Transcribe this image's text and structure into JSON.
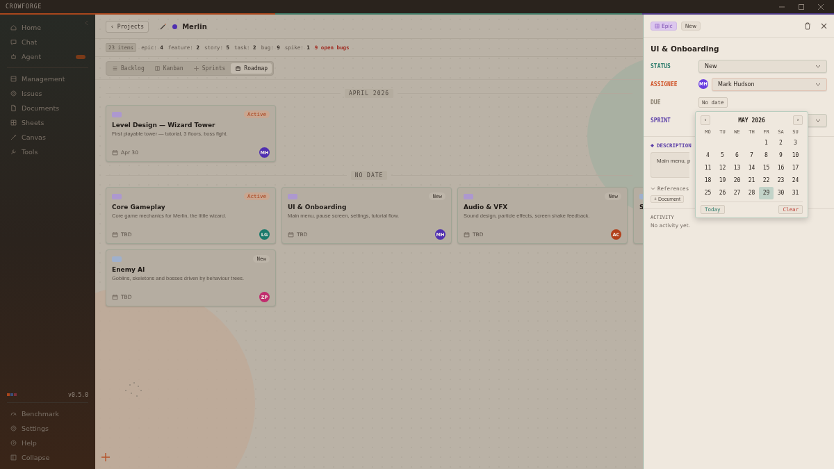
{
  "app": {
    "title": "CROWFORGE"
  },
  "sidebar": {
    "groups": [
      [
        {
          "label": "Home",
          "has_badge": false
        },
        {
          "label": "Chat",
          "has_badge": false
        },
        {
          "label": "Agent",
          "has_badge": true
        }
      ],
      [
        {
          "label": "Management",
          "has_badge": false
        },
        {
          "label": "Issues",
          "has_badge": false
        },
        {
          "label": "Documents",
          "has_badge": false
        },
        {
          "label": "Sheets",
          "has_badge": false
        },
        {
          "label": "Canvas",
          "has_badge": false
        },
        {
          "label": "Tools",
          "has_badge": false
        }
      ]
    ],
    "swatches": [
      {
        "color": "#a9461c"
      },
      {
        "color": "#3c4f7a"
      },
      {
        "color": "#7a2f3a"
      }
    ],
    "version": "v0.5.0",
    "footer": [
      {
        "label": "Benchmark"
      },
      {
        "label": "Settings"
      },
      {
        "label": "Help"
      },
      {
        "label": "Collapse"
      }
    ]
  },
  "project": {
    "back": "‹ Projects",
    "name": "Merlin",
    "color": "#4f2fb0"
  },
  "stats": {
    "total": "23 items",
    "counts": [
      {
        "key": "epic:",
        "value": "4"
      },
      {
        "key": "feature:",
        "value": "2"
      },
      {
        "key": "story:",
        "value": "5"
      },
      {
        "key": "task:",
        "value": "2"
      },
      {
        "key": "bug:",
        "value": "9"
      },
      {
        "key": "spike:",
        "value": "1"
      }
    ],
    "alert": "9 open bugs"
  },
  "tabs": [
    {
      "label": "Backlog",
      "selected": false
    },
    {
      "label": "Kanban",
      "selected": false
    },
    {
      "label": "Sprints",
      "selected": false
    },
    {
      "label": "Roadmap",
      "selected": true
    }
  ],
  "roadmap": [
    {
      "heading": "APRIL 2026",
      "cards": [
        {
          "title": "Level Design — Wizard Tower",
          "description": "First playable tower — tutorial, 3 floors, boss fight.",
          "date": "Apr 30",
          "status": {
            "label": "Active",
            "active": true
          },
          "tag": {
            "color": "#ad98cf"
          },
          "avatar": {
            "initials": "MH",
            "color": "#4f2fb0"
          }
        }
      ]
    },
    {
      "heading": "NO DATE",
      "cards": [
        {
          "title": "Core Gameplay",
          "description": "Core game mechanics for Merlin, the little wizard.",
          "date": "TBD",
          "status": {
            "label": "Active",
            "active": true
          },
          "tag": {
            "color": "#ad98cf"
          },
          "avatar": {
            "initials": "LG",
            "color": "#1a7a6c"
          }
        },
        {
          "title": "UI & Onboarding",
          "description": "Main menu, pause screen, settings, tutorial flow.",
          "date": "TBD",
          "status": {
            "label": "New",
            "active": false
          },
          "tag": {
            "color": "#ad98cf"
          },
          "avatar": {
            "initials": "MH",
            "color": "#4f2fb0"
          }
        },
        {
          "title": "Audio & VFX",
          "description": "Sound design, particle effects, screen shake feedback.",
          "date": "TBD",
          "status": {
            "label": "New",
            "active": false
          },
          "tag": {
            "color": "#ad98cf"
          },
          "avatar": {
            "initials": "AC",
            "color": "#b2401b"
          }
        },
        {
          "title": "S",
          "tag": {
            "color": "#9fb0cc"
          }
        },
        {
          "title": "Enemy AI",
          "description": "Goblins, skeletons and bosses driven by behaviour trees.",
          "date": "TBD",
          "status": {
            "label": "New",
            "active": false
          },
          "tag": {
            "color": "#9fb0cc"
          },
          "avatar": {
            "initials": "ZP",
            "color": "#c02c6e"
          }
        }
      ]
    }
  ],
  "panel": {
    "type": "Epic",
    "status": "New",
    "title": "UI & Onboarding",
    "fields": [
      {
        "label": "STATUS",
        "kind": "select",
        "value": "New",
        "color": "#2f7d6d"
      },
      {
        "label": "ASSIGNEE",
        "kind": "person",
        "value": "Mark Hudson",
        "avatar": {
          "initials": "MH",
          "color": "#6a3de0"
        },
        "color": "#d0552a"
      },
      {
        "label": "DUE",
        "kind": "date",
        "value": "No date",
        "color": "#8a8070"
      },
      {
        "label": "SPRINT",
        "kind": "select",
        "color": "#5b3fa8"
      }
    ],
    "description_label": "DESCRIPTION",
    "description": "Main menu, p",
    "references": "References",
    "add_reference": "+ Document",
    "activity_label": "ACTIVITY",
    "activity": "No activity yet."
  },
  "calendar": {
    "prev": "‹",
    "next": "›",
    "month": "MAY 2026",
    "weekdays": [
      "MO",
      "TU",
      "WE",
      "TH",
      "FR",
      "SA",
      "SU"
    ],
    "weeks": [
      [
        {
          "kind": "blank"
        },
        {
          "kind": "blank"
        },
        {
          "kind": "blank"
        },
        {
          "kind": "blank"
        },
        {
          "kind": "day",
          "d": "1",
          "selected": false
        },
        {
          "kind": "day",
          "d": "2",
          "selected": false
        },
        {
          "kind": "day",
          "d": "3",
          "selected": false
        }
      ],
      [
        {
          "kind": "day",
          "d": "4",
          "selected": false
        },
        {
          "kind": "day",
          "d": "5",
          "selected": false
        },
        {
          "kind": "day",
          "d": "6",
          "selected": false
        },
        {
          "kind": "day",
          "d": "7",
          "selected": false
        },
        {
          "kind": "day",
          "d": "8",
          "selected": false
        },
        {
          "kind": "day",
          "d": "9",
          "selected": false
        },
        {
          "kind": "day",
          "d": "10",
          "selected": false
        }
      ],
      [
        {
          "kind": "day",
          "d": "11",
          "selected": false
        },
        {
          "kind": "day",
          "d": "12",
          "selected": false
        },
        {
          "kind": "day",
          "d": "13",
          "selected": false
        },
        {
          "kind": "day",
          "d": "14",
          "selected": false
        },
        {
          "kind": "day",
          "d": "15",
          "selected": false
        },
        {
          "kind": "day",
          "d": "16",
          "selected": false
        },
        {
          "kind": "day",
          "d": "17",
          "selected": false
        }
      ],
      [
        {
          "kind": "day",
          "d": "18",
          "selected": false
        },
        {
          "kind": "day",
          "d": "19",
          "selected": false
        },
        {
          "kind": "day",
          "d": "20",
          "selected": false
        },
        {
          "kind": "day",
          "d": "21",
          "selected": false
        },
        {
          "kind": "day",
          "d": "22",
          "selected": false
        },
        {
          "kind": "day",
          "d": "23",
          "selected": false
        },
        {
          "kind": "day",
          "d": "24",
          "selected": false
        }
      ],
      [
        {
          "kind": "day",
          "d": "25",
          "selected": false
        },
        {
          "kind": "day",
          "d": "26",
          "selected": false
        },
        {
          "kind": "day",
          "d": "27",
          "selected": false
        },
        {
          "kind": "day",
          "d": "28",
          "selected": false
        },
        {
          "kind": "day",
          "d": "29",
          "selected": true
        },
        {
          "kind": "day",
          "d": "30",
          "selected": false
        },
        {
          "kind": "day",
          "d": "31",
          "selected": false
        }
      ]
    ],
    "today": "Today",
    "clear": "Clear"
  }
}
